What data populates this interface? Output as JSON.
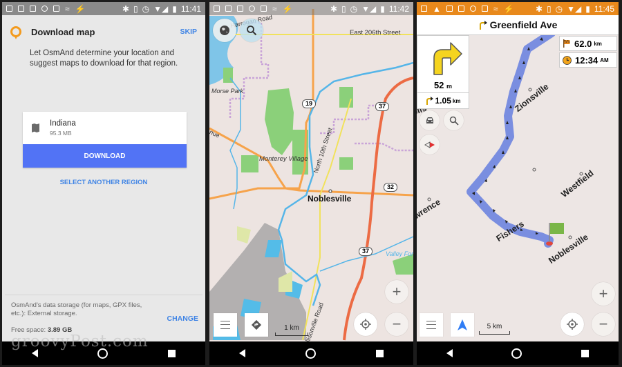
{
  "watermark": "groovyPost.com",
  "screens": [
    {
      "status_time": "11:41",
      "header": {
        "title": "Download map",
        "skip_label": "SKIP"
      },
      "description": "Let OsmAnd determine your location and suggest maps to download for that region.",
      "region_card": {
        "name": "Indiana",
        "size": "95.3 MB",
        "download_label": "DOWNLOAD"
      },
      "select_another_label": "SELECT ANOTHER REGION",
      "storage": {
        "text": "OsmAnd's data storage (for maps, GPX files, etc.): External storage.",
        "free_label": "Free space:",
        "free_value": "3.89 GB",
        "change_label": "CHANGE"
      }
    },
    {
      "status_time": "11:42",
      "map_labels": {
        "road1": "Harrogan Road",
        "road2": "East 206th Street",
        "park": "Morse Park",
        "avenue_fragment": "nue",
        "village": "Monterey Village",
        "street": "North 10th Street",
        "town": "Noblesville",
        "road3": "Allisonville Road",
        "forge": "Valley Forge"
      },
      "shields": [
        "19",
        "37",
        "32",
        "37"
      ],
      "scale_label": "1 km"
    },
    {
      "status_time": "11:45",
      "street_name": "Greenfield Ave",
      "turn_distance": {
        "value": "52",
        "unit": "m"
      },
      "next_turn": {
        "value": "1.05",
        "unit": "km"
      },
      "remaining_distance": {
        "value": "62.0",
        "unit": "km"
      },
      "arrival_time": {
        "value": "12:34",
        "unit": "AM"
      },
      "cities": [
        "Zionsville",
        "Westfield",
        "Lawrence",
        "Fishers",
        "Noblesville",
        "olis"
      ],
      "scale_label": "5 km"
    }
  ],
  "colors": {
    "accent_blue": "#3f84e5",
    "download_button": "#5273f5",
    "osmand_orange": "#e8891c",
    "route_blue": "#7a8ee0"
  }
}
